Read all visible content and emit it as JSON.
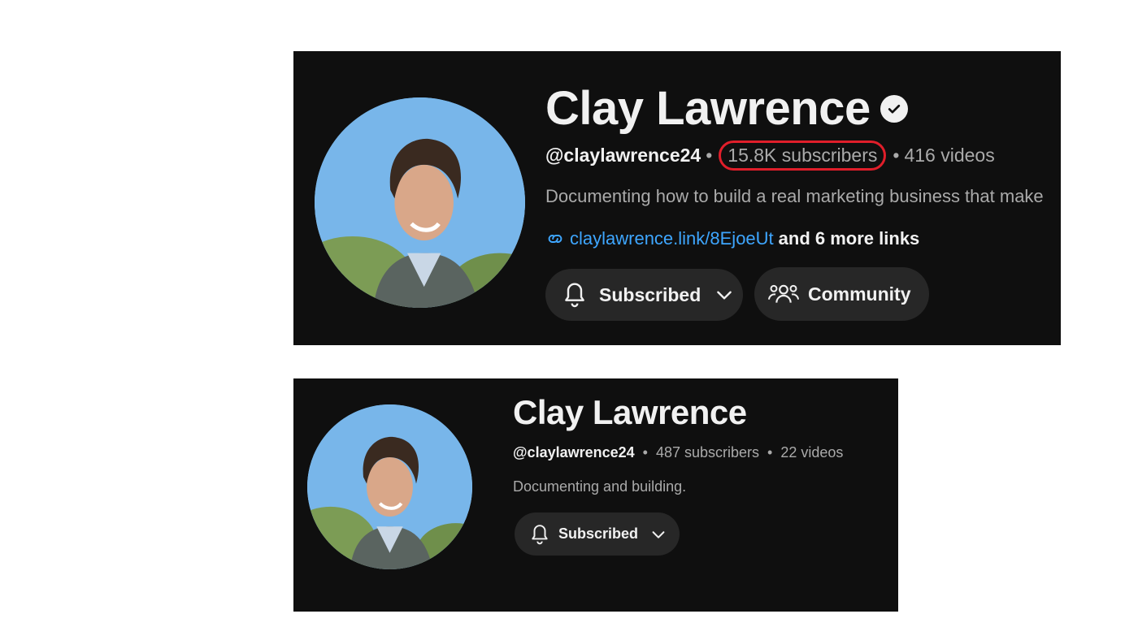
{
  "top_card": {
    "channel_name": "Clay Lawrence",
    "verified_icon": "verified-check-icon",
    "handle": "@claylawrence24",
    "separator": "•",
    "subscribers": "15.8K subscribers",
    "videos": "416 videos",
    "description": "Documenting how to build a real marketing business that make",
    "link_text": "claylawrence.link/8EjoeUt",
    "more_links": "and 6 more links",
    "subscribe_button_label": "Subscribed",
    "community_button_label": "Community",
    "highlight_color": "#e01e2a"
  },
  "bottom_card": {
    "channel_name": "Clay Lawrence",
    "handle": "@claylawrence24",
    "separator": "•",
    "subscribers": "487 subscribers",
    "videos": "22 videos",
    "description": "Documenting and building.",
    "subscribe_button_label": "Subscribed"
  },
  "colors": {
    "panel_background": "#0f0f0f",
    "button_background": "#272727",
    "link": "#3ea6ff",
    "secondary_text": "#aaaaaa",
    "primary_text": "#f1f1f1"
  }
}
